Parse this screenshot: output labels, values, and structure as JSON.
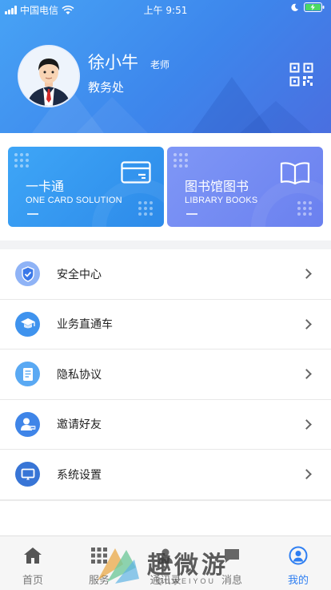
{
  "status_bar": {
    "carrier": "中国电信",
    "time": "上午 9:51"
  },
  "profile": {
    "name": "徐小牛",
    "role": "老师",
    "department": "教务处"
  },
  "cards": [
    {
      "title": "一卡通",
      "subtitle": "ONE CARD SOLUTION"
    },
    {
      "title": "图书馆图书",
      "subtitle": "LIBRARY BOOKS"
    }
  ],
  "menu": [
    {
      "label": "安全中心",
      "icon": "shield-icon",
      "color": "#6e9df4"
    },
    {
      "label": "业务直通车",
      "icon": "graduation-cap-icon",
      "color": "#3f93ee"
    },
    {
      "label": "隐私协议",
      "icon": "document-icon",
      "color": "#4fa3f2"
    },
    {
      "label": "邀请好友",
      "icon": "add-user-icon",
      "color": "#3f85e8"
    },
    {
      "label": "系统设置",
      "icon": "monitor-icon",
      "color": "#3875d6"
    }
  ],
  "tabs": [
    {
      "label": "首页",
      "icon": "home-icon",
      "active": false
    },
    {
      "label": "服务",
      "icon": "grid-icon",
      "active": false
    },
    {
      "label": "通讯录",
      "icon": "contacts-icon",
      "active": false
    },
    {
      "label": "消息",
      "icon": "message-icon",
      "active": false
    },
    {
      "label": "我的",
      "icon": "profile-icon",
      "active": true
    }
  ],
  "watermark": {
    "text": "趣微游",
    "sub": "QUWEIYOU"
  },
  "colors": {
    "accent": "#2f7ff2",
    "header_start": "#47a3f5",
    "header_end": "#4a6fe0",
    "card_1": "#2d8ae9",
    "card_2": "#6a80ef"
  }
}
